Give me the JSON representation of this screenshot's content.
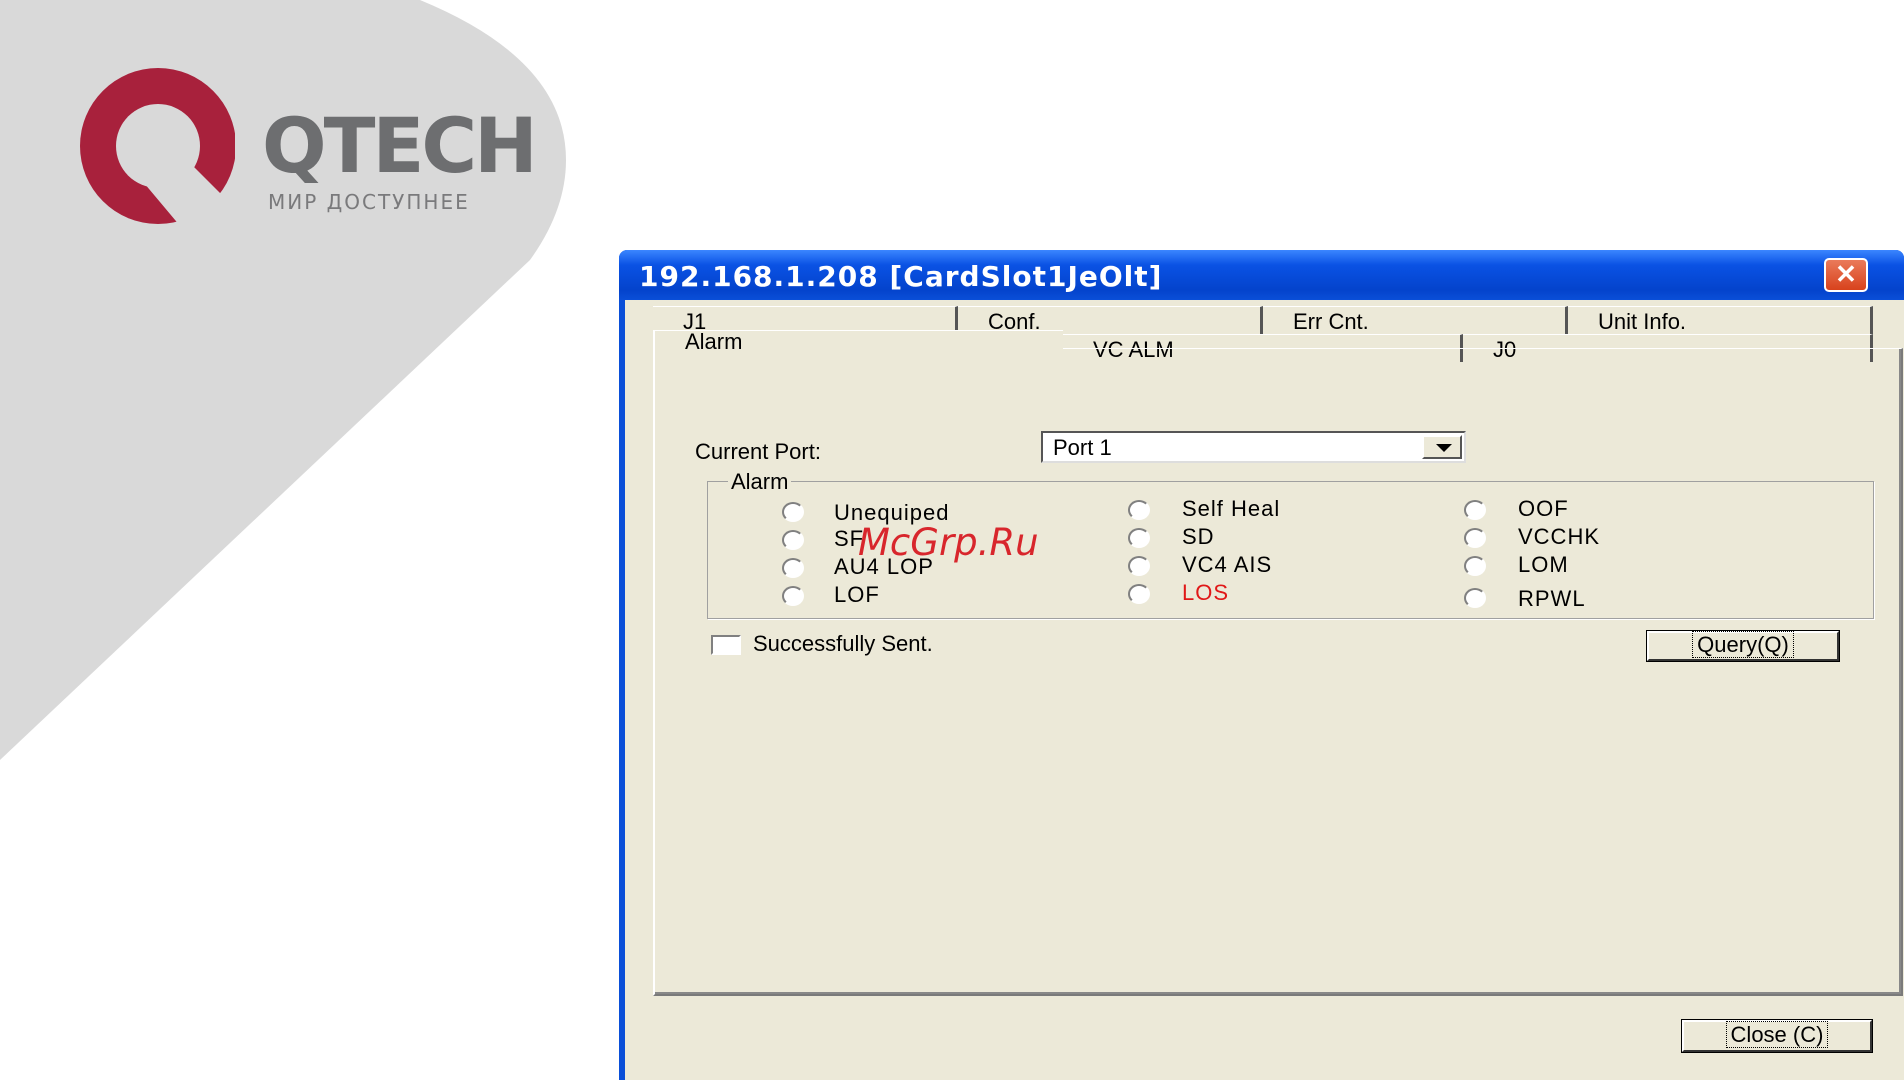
{
  "brand": {
    "logo_text": "QTECH",
    "tagline": "МИР ДОСТУПНЕЕ",
    "logo_color": "#a8213c",
    "bg_shape_color": "#d9d9d9"
  },
  "window": {
    "title": "192.168.1.208  [CardSlot1JeOlt]",
    "close_icon": "close-icon"
  },
  "tabs": {
    "row1": [
      "J1",
      "Conf.",
      "Err Cnt.",
      "Unit Info."
    ],
    "row2": [
      "Alarm",
      "VC ALM",
      "J0"
    ],
    "active": "Alarm"
  },
  "current_port": {
    "label": "Current Port:",
    "value": "Port 1"
  },
  "alarm_group": {
    "title": "Alarm",
    "items": [
      "Unequiped",
      "SF",
      "AU4 LOP",
      "LOF",
      "Self Heal",
      "SD",
      "VC4 AIS",
      "LOS",
      "OOF",
      "VCCHK",
      "LOM",
      "RPWL"
    ],
    "highlight": "LOS",
    "highlight_color": "#e01818"
  },
  "status": {
    "sent_label": "Successfully Sent."
  },
  "buttons": {
    "query": "Query(Q)",
    "close": "Close (C)"
  },
  "watermark": "McGrp.Ru"
}
